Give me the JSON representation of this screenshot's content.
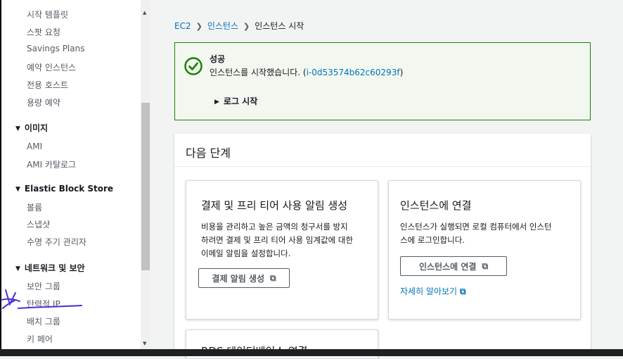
{
  "sidebar": {
    "items_top": [
      {
        "label": "시작 템플릿"
      },
      {
        "label": "스팟 요청"
      },
      {
        "label": "Savings Plans"
      },
      {
        "label": "예약 인스턴스"
      },
      {
        "label": "전용 호스트"
      },
      {
        "label": "용량 예약"
      }
    ],
    "group_images": {
      "label": "이미지",
      "items": [
        {
          "label": "AMI"
        },
        {
          "label": "AMI 카탈로그"
        }
      ]
    },
    "group_ebs": {
      "label": "Elastic Block Store",
      "items": [
        {
          "label": "볼륨"
        },
        {
          "label": "스냅샷"
        },
        {
          "label": "수명 주기 관리자"
        }
      ]
    },
    "group_network": {
      "label": "네트워크 및 보안",
      "items": [
        {
          "label": "보안 그룹"
        },
        {
          "label": "탄력적 IP"
        },
        {
          "label": "배치 그룹"
        },
        {
          "label": "키 페어"
        }
      ]
    }
  },
  "breadcrumb": {
    "root": "EC2",
    "middle": "인스턴스",
    "current": "인스턴스 시작"
  },
  "flash": {
    "title": "성공",
    "message": "인스턴스를 시작했습니다. (",
    "instance_id": "i-0d53574b62c60293f",
    "message_end": ")",
    "log_label": "로그 시작"
  },
  "next_steps": {
    "title": "다음 단계",
    "card_billing": {
      "title": "결제 및 프리 티어 사용 알림 생성",
      "body_lines": [
        "비용을 관리하고 높은 금액의 청구서를 방지",
        "하려면 결제 및 프리 티어 사용 임계값에 대한",
        "이메일 알림을 설정합니다."
      ],
      "button": "결제 알림 생성"
    },
    "card_connect": {
      "title": "인스턴스에 연결",
      "body_lines": [
        "인스턴스가 실행되면 로컬 컴퓨터에서 인스턴",
        "스에 로그인합니다."
      ],
      "button": "인스턴스에 연결",
      "link": "자세히 알아보기"
    },
    "card_rds": {
      "title": "RDS 데이터베이스 연결"
    }
  },
  "colors": {
    "link": "#0073bb",
    "success": "#1d8102",
    "success_bg": "#f2f8f0",
    "annotation": "#4b2bd6"
  }
}
